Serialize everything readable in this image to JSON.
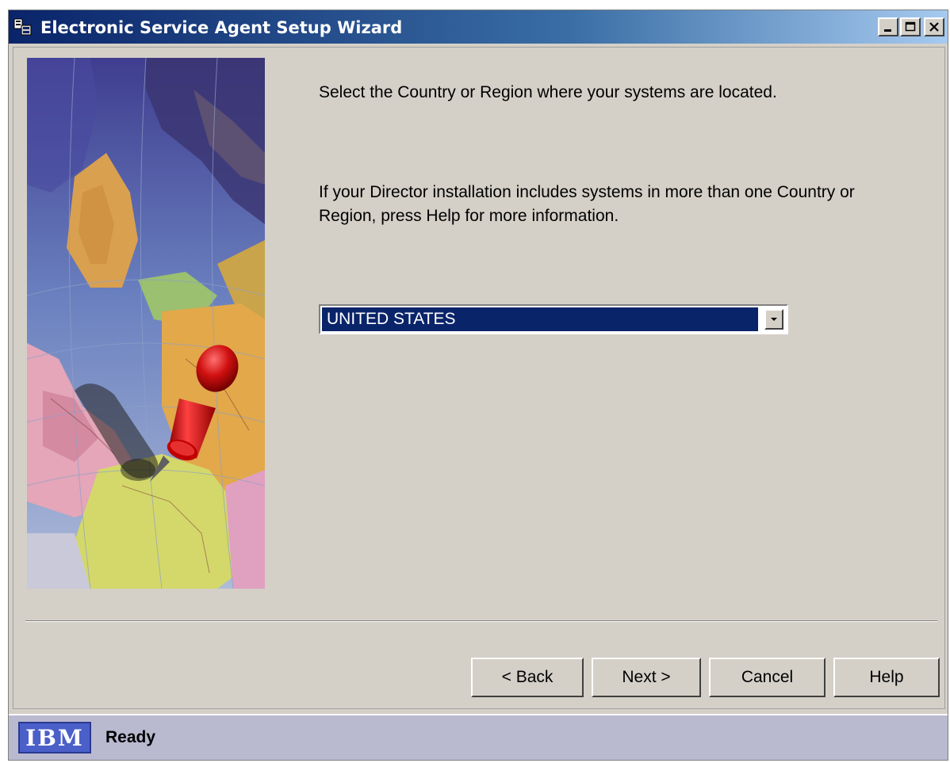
{
  "window": {
    "title": "Electronic Service Agent Setup Wizard",
    "controls": [
      "minimize-icon",
      "maximize-icon",
      "close-icon"
    ]
  },
  "main": {
    "instruction": "Select the Country or Region where your systems are located.",
    "help_note": "If your Director installation includes systems in more than one Country or Region, press Help for more information.",
    "country_select": {
      "selected": "UNITED STATES"
    }
  },
  "buttons": {
    "back": "< Back",
    "next": "Next >",
    "cancel": "Cancel",
    "help": "Help"
  },
  "status": {
    "logo": "IBM",
    "text": "Ready"
  },
  "colors": {
    "titlebar_start": "#0a246a",
    "titlebar_end": "#a6caf0",
    "selection": "#0a246a",
    "window_bg": "#d4d0c8",
    "statusbar": "#b9b9d0",
    "pushpin": "#cc1010"
  }
}
